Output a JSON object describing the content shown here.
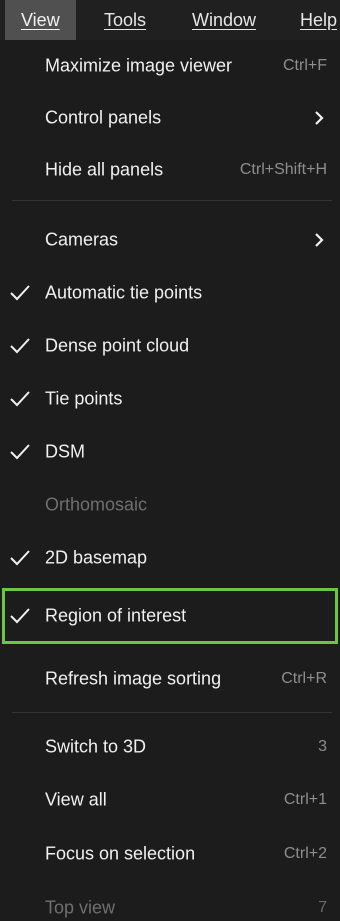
{
  "menubar": {
    "items": [
      {
        "label": "View"
      },
      {
        "label": "Tools"
      },
      {
        "label": "Window"
      },
      {
        "label": "Help"
      }
    ]
  },
  "menu": {
    "items": [
      {
        "label": "Maximize image viewer",
        "shortcut": "Ctrl+F",
        "checked": false,
        "submenu": false,
        "enabled": true
      },
      {
        "label": "Control panels",
        "shortcut": "",
        "checked": false,
        "submenu": true,
        "enabled": true
      },
      {
        "label": "Hide all panels",
        "shortcut": "Ctrl+Shift+H",
        "checked": false,
        "submenu": false,
        "enabled": true
      },
      {
        "label": "Cameras",
        "shortcut": "",
        "checked": false,
        "submenu": true,
        "enabled": true
      },
      {
        "label": "Automatic tie points",
        "shortcut": "",
        "checked": true,
        "submenu": false,
        "enabled": true
      },
      {
        "label": "Dense point cloud",
        "shortcut": "",
        "checked": true,
        "submenu": false,
        "enabled": true
      },
      {
        "label": "Tie points",
        "shortcut": "",
        "checked": true,
        "submenu": false,
        "enabled": true
      },
      {
        "label": "DSM",
        "shortcut": "",
        "checked": true,
        "submenu": false,
        "enabled": true
      },
      {
        "label": "Orthomosaic",
        "shortcut": "",
        "checked": false,
        "submenu": false,
        "enabled": false
      },
      {
        "label": "2D basemap",
        "shortcut": "",
        "checked": true,
        "submenu": false,
        "enabled": true
      },
      {
        "label": "Region of interest",
        "shortcut": "",
        "checked": true,
        "submenu": false,
        "enabled": true,
        "highlighted": true
      },
      {
        "label": "Refresh image sorting",
        "shortcut": "Ctrl+R",
        "checked": false,
        "submenu": false,
        "enabled": true
      },
      {
        "label": "Switch to 3D",
        "shortcut": "3",
        "checked": false,
        "submenu": false,
        "enabled": true
      },
      {
        "label": "View all",
        "shortcut": "Ctrl+1",
        "checked": false,
        "submenu": false,
        "enabled": true
      },
      {
        "label": "Focus on selection",
        "shortcut": "Ctrl+2",
        "checked": false,
        "submenu": false,
        "enabled": true
      },
      {
        "label": "Top view",
        "shortcut": "7",
        "checked": false,
        "submenu": false,
        "enabled": false
      }
    ]
  },
  "colors": {
    "highlight_outline": "#6cc644",
    "menu_background": "#1c1c1c",
    "active_menu_background": "#505050"
  }
}
